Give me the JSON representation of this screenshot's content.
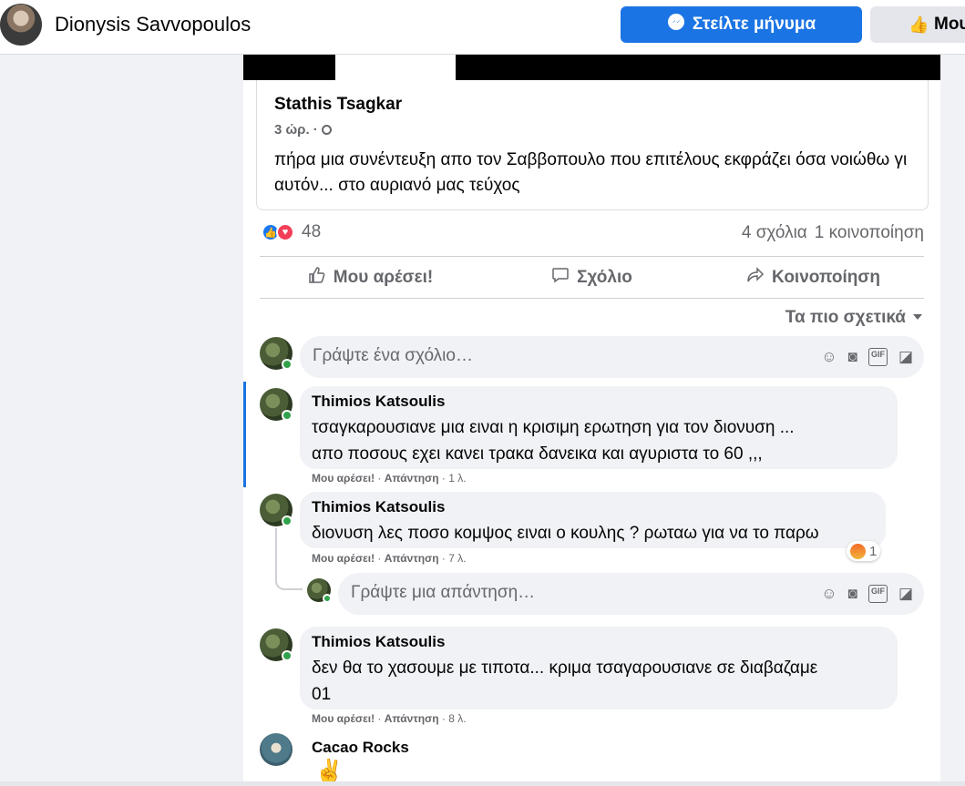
{
  "header": {
    "page_name": "Dionysis Savvopoulos",
    "message_button": "Στείλτε μήνυμα",
    "like_button": "Μου"
  },
  "post": {
    "shared": {
      "author": "Stathis Tsagkar",
      "time": "3 ώρ. ·",
      "text": "πήρα μια συνέντευξη απο τον Σαββοπουλο που επιτέλους εκφράζει όσα νοιώθω γι αυτόν... στο αυριανό μας τεύχος"
    },
    "reaction_count": "48",
    "comments_count": "4 σχόλια",
    "shares_count": "1 κοινοποίηση",
    "actions": {
      "like": "Μου αρέσει!",
      "comment": "Σχόλιο",
      "share": "Κοινοποίηση"
    },
    "sort_label": "Τα πιο σχετικά"
  },
  "composer": {
    "placeholder": "Γράψτε ένα σχόλιο…"
  },
  "reply_composer": {
    "placeholder": "Γράψτε μια απάντηση…"
  },
  "comments": [
    {
      "name": "Thimios Katsoulis",
      "text_line1": "τσαγκαρουσιανε μια ειναι η κρισιμη ερωτηση για τον διονυση ...",
      "text_line2": "απο ποσους εχει κανει τρακα δανεικα και αγυριστα το 60 ,,,",
      "like": "Μου αρέσει!",
      "reply": "Απάντηση",
      "time": "1 λ."
    },
    {
      "name": "Thimios Katsoulis",
      "text_line1": "διονυση λες ποσο κομψος ειναι ο κουλης ? ρωταω για να το παρω",
      "like": "Μου αρέσει!",
      "reply": "Απάντηση",
      "time": "7 λ.",
      "reaction_count": "1"
    },
    {
      "name": "Thimios Katsoulis",
      "text_line1": "δεν θα το χασουμε με τιποτα... κριμα τσαγαρουσιανε σε διαβαζαμε",
      "text_line2": "01",
      "like": "Μου αρέσει!",
      "reply": "Απάντηση",
      "time": "8 λ."
    },
    {
      "name": "Cacao Rocks",
      "text_line1": "✌"
    }
  ],
  "colors": {
    "accent": "#1b74e4",
    "online": "#31a24c",
    "muted": "#65676b"
  }
}
